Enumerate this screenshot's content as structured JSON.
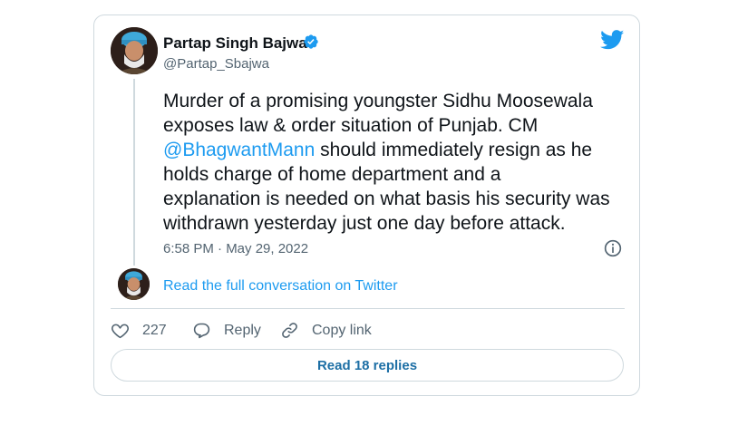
{
  "author": {
    "name": "Partap Singh Bajwa",
    "handle": "@Partap_Sbajwa"
  },
  "tweet": {
    "text_before": "Murder of a promising youngster Sidhu Moosewala\nexposes law & order situation of Punjab. CM\n",
    "mention": "@BhagwantMann",
    "text_after": " should immediately resign as he\nholds charge of home department and a\nexplanation is needed on what basis his security was\nwithdrawn yesterday just one day before attack.",
    "timestamp": "6:58 PM · May 29, 2022"
  },
  "conversation_link": "Read the full conversation on Twitter",
  "actions": {
    "likes": "227",
    "reply_label": "Reply",
    "copy_label": "Copy link"
  },
  "replies_button": "Read 18 replies",
  "colors": {
    "accent": "#1d9bf0",
    "muted": "#536471",
    "border": "#cfd9de"
  }
}
